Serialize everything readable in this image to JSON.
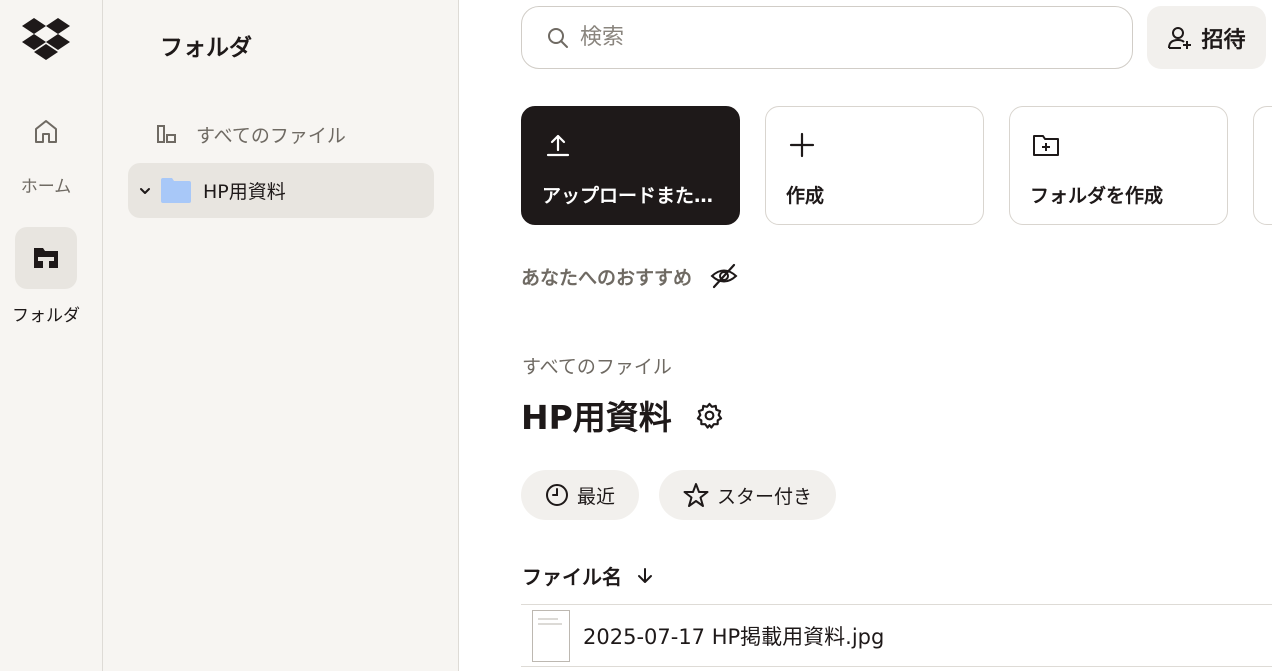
{
  "rail": {
    "home_label": "ホーム",
    "folders_label": "フォルダ"
  },
  "tree": {
    "title": "フォルダ",
    "all_files": "すべてのファイル",
    "folder_name": "HP用資料"
  },
  "header": {
    "search_placeholder": "検索",
    "invite_label": "招待"
  },
  "actions": {
    "upload_label": "アップロードまたは作成",
    "create_label": "作成",
    "new_folder_label": "フォルダを作成"
  },
  "suggestions": {
    "label": "あなたへのおすすめ"
  },
  "content": {
    "breadcrumb": "すべてのファイル",
    "title": "HP用資料",
    "chips": {
      "recent": "最近",
      "starred": "スター付き"
    },
    "column_name": "ファイル名",
    "files": [
      {
        "name": "2025-07-17 HP掲載用資料.jpg"
      }
    ]
  },
  "colors": {
    "primary_dark": "#1e1919",
    "sidebar_bg": "#f7f5f2",
    "selected_bg": "#e8e5e0",
    "folder_blue": "#a8c8f8",
    "muted_text": "#6f6a63"
  },
  "icons": {
    "logo": "dropbox-logo",
    "home": "home-icon",
    "folders": "folder-rail-icon",
    "all_files": "all-files-icon",
    "chevron": "chevron-down-icon",
    "folder": "folder-icon",
    "search": "search-icon",
    "invite": "person-add-icon",
    "upload": "upload-icon",
    "plus": "plus-icon",
    "new_folder": "folder-plus-icon",
    "hide": "eye-off-icon",
    "settings": "gear-icon",
    "clock": "clock-icon",
    "star": "star-icon",
    "sort": "arrow-down-icon"
  }
}
